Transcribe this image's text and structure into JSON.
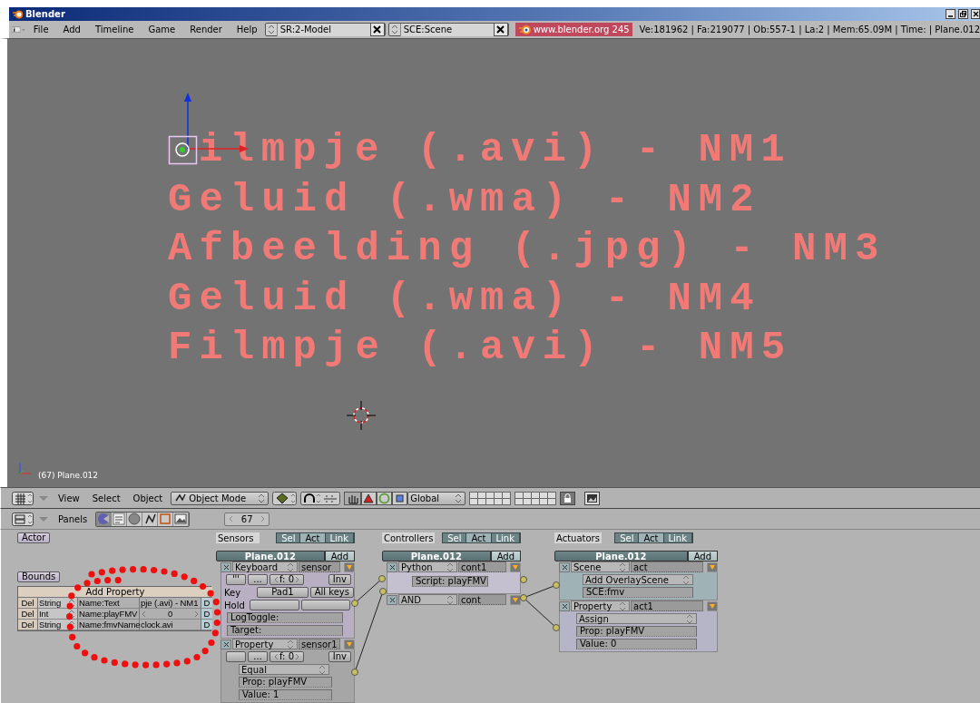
{
  "window": {
    "title": "Blender"
  },
  "menu_bar": {
    "menus": [
      "File",
      "Add",
      "Timeline",
      "Game",
      "Render",
      "Help"
    ],
    "screen": "SR:2-Model",
    "scene": "SCE:Scene",
    "website": "www.blender.org 245",
    "stats": "Ve:181962 | Fa:219077 | Ob:557-1 | La:2  | Mem:65.09M  | Time: | Plane.012"
  },
  "viewport": {
    "text_objects": [
      "ilmpje (.avi) - NM1",
      "Geluid (.wma) - NM2",
      "Afbeelding (.jpg) - NM3",
      "Geluid (.wma) - NM4",
      "Filmpje (.avi) - NM5"
    ],
    "status": "(67) Plane.012"
  },
  "view_header": {
    "menus": [
      "View",
      "Select",
      "Object"
    ],
    "mode": "Object Mode",
    "orientation": "Global"
  },
  "buttons_header": {
    "label": "Panels",
    "frame": "67",
    "tabs": [
      {
        "kind": "logic",
        "selected": true
      },
      {
        "kind": "script",
        "selected": false
      },
      {
        "kind": "shading",
        "selected": false
      },
      {
        "kind": "object",
        "selected": false
      },
      {
        "kind": "editing",
        "selected": false
      },
      {
        "kind": "scene",
        "selected": false
      }
    ]
  },
  "logic": {
    "actor": "Actor",
    "bounds": "Bounds",
    "add_property": "Add Property",
    "properties": [
      {
        "kind": "text",
        "delete": "Del",
        "type": "String",
        "name": "Name:Text",
        "value": "pje (.avi) - NM1",
        "debug": "D"
      },
      {
        "kind": "number",
        "delete": "Del",
        "type": "Int",
        "name": "Name:playFMV",
        "value": "0",
        "debug": "D"
      },
      {
        "kind": "text",
        "delete": "Del",
        "type": "String",
        "name": "Name:fmvName",
        "value": "clock.avi",
        "debug": "D"
      }
    ],
    "columns": [
      {
        "label": "Sensors",
        "filters": [
          {
            "label": "Sel",
            "on": false
          },
          {
            "label": "Act",
            "on": true
          },
          {
            "label": "Link",
            "on": false
          }
        ],
        "object": "Plane.012",
        "add": "Add",
        "bricks": [
          {
            "kind": "keyboard",
            "type": "Keyboard",
            "name": "sensor",
            "true_pulse": "'''",
            "false_pulse": "...",
            "frequency": "f: 0",
            "invert": "Inv",
            "key_label": "Key",
            "key": "Pad1",
            "all_keys": "All keys",
            "hold_label": "Hold",
            "toggle": "LogToggle:",
            "target": "Target:"
          },
          {
            "kind": "property",
            "type": "Property",
            "name": "sensor1",
            "false_pulse": "...",
            "frequency": "f: 0",
            "invert": "Inv",
            "mode": "Equal",
            "prop": "Prop: playFMV",
            "value": "Value: 1"
          }
        ]
      },
      {
        "label": "Controllers",
        "filters": [
          {
            "label": "Sel",
            "on": false
          },
          {
            "label": "Act",
            "on": true
          },
          {
            "label": "Link",
            "on": false
          }
        ],
        "object": "Plane.012",
        "add": "Add",
        "bricks": [
          {
            "kind": "python",
            "type": "Python",
            "name": "cont1",
            "script": "Script: playFMV"
          },
          {
            "kind": "and",
            "type": "AND",
            "name": "cont"
          }
        ]
      },
      {
        "label": "Actuators",
        "filters": [
          {
            "label": "Sel",
            "on": false
          },
          {
            "label": "Act",
            "on": true
          },
          {
            "label": "Link",
            "on": false
          }
        ],
        "object": "Plane.012",
        "add": "Add",
        "bricks": [
          {
            "kind": "scene",
            "type": "Scene",
            "name": "act",
            "mode": "Add OverlayScene",
            "scene": "SCE:fmv"
          },
          {
            "kind": "property",
            "type": "Property",
            "name": "act1",
            "mode": "Assign",
            "prop": "Prop: playFMV",
            "value": "Value: 0"
          }
        ]
      }
    ]
  }
}
